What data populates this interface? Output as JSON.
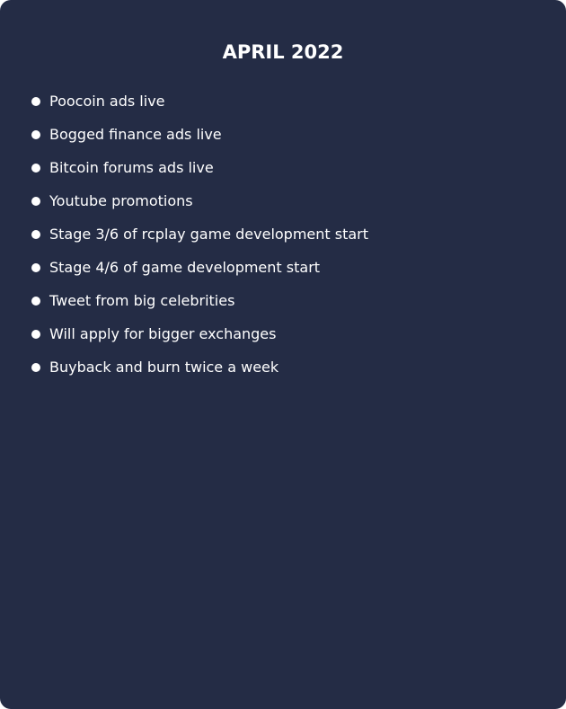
{
  "card": {
    "title": "APRIL 2022",
    "items": [
      {
        "label": "Poocoin ads live"
      },
      {
        "label": "Bogged finance ads live"
      },
      {
        "label": "Bitcoin forums ads live"
      },
      {
        "label": "Youtube promotions"
      },
      {
        "label": "Stage 3/6 of rcplay game development start"
      },
      {
        "label": "Stage 4/6 of game development start"
      },
      {
        "label": "Tweet from big celebrities"
      },
      {
        "label": "Will apply for bigger exchanges"
      },
      {
        "label": "Buyback and burn twice a week"
      }
    ]
  },
  "colors": {
    "card_background": "#242c45",
    "text": "#ffffff"
  }
}
